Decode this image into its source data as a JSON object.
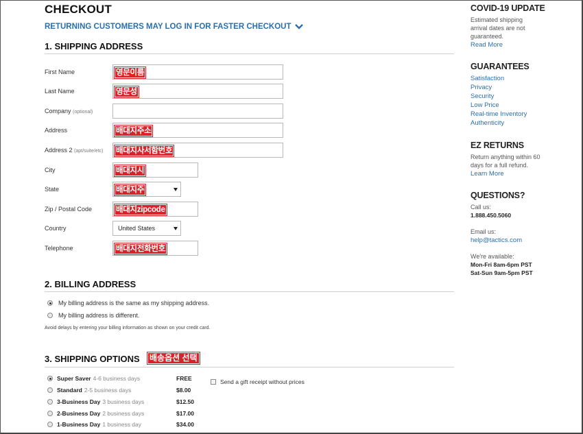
{
  "page": {
    "title": "CHECKOUT",
    "returning_link": "RETURNING CUSTOMERS MAY LOG IN FOR FASTER CHECKOUT"
  },
  "shipping_address": {
    "title": "1. SHIPPING ADDRESS",
    "fields": [
      {
        "label": "First Name",
        "optional": "",
        "value": "영문이름"
      },
      {
        "label": "Last Name",
        "optional": "",
        "value": "영문성"
      },
      {
        "label": "Company",
        "optional": "(optional)",
        "value": ""
      },
      {
        "label": "Address",
        "optional": "",
        "value": "배대지주소"
      },
      {
        "label": "Address 2",
        "optional": "(apt/suite/etc)",
        "value": "배대지사서함번호"
      },
      {
        "label": "City",
        "optional": "",
        "value": "배대지시"
      },
      {
        "label": "State",
        "optional": "",
        "value": "배대지주"
      },
      {
        "label": "Zip / Postal Code",
        "optional": "",
        "value": "배대지zipcode"
      },
      {
        "label": "Country",
        "optional": "",
        "value": "United States"
      },
      {
        "label": "Telephone",
        "optional": "",
        "value": "배대지전화번호"
      }
    ]
  },
  "billing_address": {
    "title": "2. BILLING ADDRESS",
    "option_same": "My billing address is the same as my shipping address.",
    "option_different": "My billing address is different.",
    "note": "Avoid delays by entering your billing information as shown on your credit card."
  },
  "shipping_options": {
    "title": "3. SHIPPING OPTIONS",
    "annotation": "배송옵션 선택",
    "options": [
      {
        "name": "Super Saver",
        "days": "4-6 business days",
        "price": "FREE",
        "selected": true
      },
      {
        "name": "Standard",
        "days": "2-5 business days",
        "price": "$8.00",
        "selected": false
      },
      {
        "name": "3-Business Day",
        "days": "3 business days",
        "price": "$12.50",
        "selected": false
      },
      {
        "name": "2-Business Day",
        "days": "2 business days",
        "price": "$17.00",
        "selected": false
      },
      {
        "name": "1-Business Day",
        "days": "1 business day",
        "price": "$34.00",
        "selected": false
      }
    ],
    "gift_receipt": "Send a gift receipt without prices"
  },
  "sidebar": {
    "covid": {
      "title": "COVID-19 UPDATE",
      "text": "Estimated shipping arrival dates are not guaranteed.",
      "link": "Read More"
    },
    "guarantees": {
      "title": "GUARANTEES",
      "links": [
        "Satisfaction",
        "Privacy",
        "Security",
        "Low Price",
        "Real-time Inventory",
        "Authenticity"
      ]
    },
    "ez_returns": {
      "title": "EZ RETURNS",
      "text": "Return anything within 60 days for a full refund.",
      "link": "Learn More"
    },
    "questions": {
      "title": "QUESTIONS?",
      "call_label": "Call us:",
      "phone": "1.888.450.5060",
      "email_label": "Email us:",
      "email": "help@tactics.com",
      "available_label": "We're available:",
      "hours_weekday": "Mon-Fri 8am-6pm PST",
      "hours_weekend": "Sat-Sun 9am-5pm PST"
    }
  },
  "colors": {
    "link": "#2a6fad",
    "annotation_red": "#d8232a"
  }
}
